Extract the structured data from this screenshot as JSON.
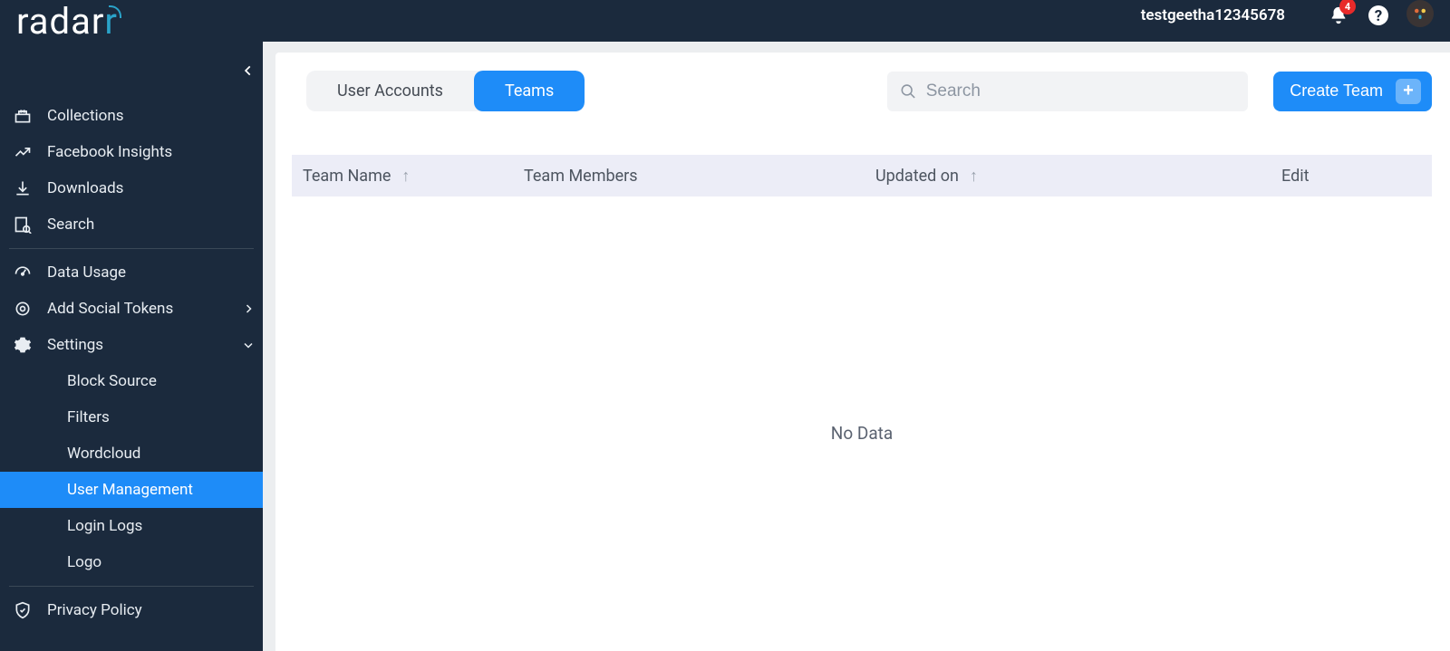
{
  "header": {
    "username": "testgeetha12345678",
    "notification_count": "4"
  },
  "logo_text_a": "radar",
  "logo_text_b": "r",
  "sidebar": {
    "items": [
      {
        "label": "Collections"
      },
      {
        "label": "Facebook Insights"
      },
      {
        "label": "Downloads"
      },
      {
        "label": "Search"
      },
      {
        "label": "Data Usage"
      },
      {
        "label": "Add Social Tokens"
      },
      {
        "label": "Settings"
      }
    ],
    "settings_children": [
      {
        "label": "Block Source"
      },
      {
        "label": "Filters"
      },
      {
        "label": "Wordcloud"
      },
      {
        "label": "User Management"
      },
      {
        "label": "Login Logs"
      },
      {
        "label": "Logo"
      }
    ],
    "privacy": "Privacy Policy"
  },
  "tabs": {
    "user_accounts": "User Accounts",
    "teams": "Teams"
  },
  "search": {
    "placeholder": "Search"
  },
  "create_team_label": "Create Team",
  "table": {
    "col_name": "Team Name",
    "col_members": "Team Members",
    "col_updated": "Updated on",
    "col_edit": "Edit",
    "no_data": "No Data"
  }
}
